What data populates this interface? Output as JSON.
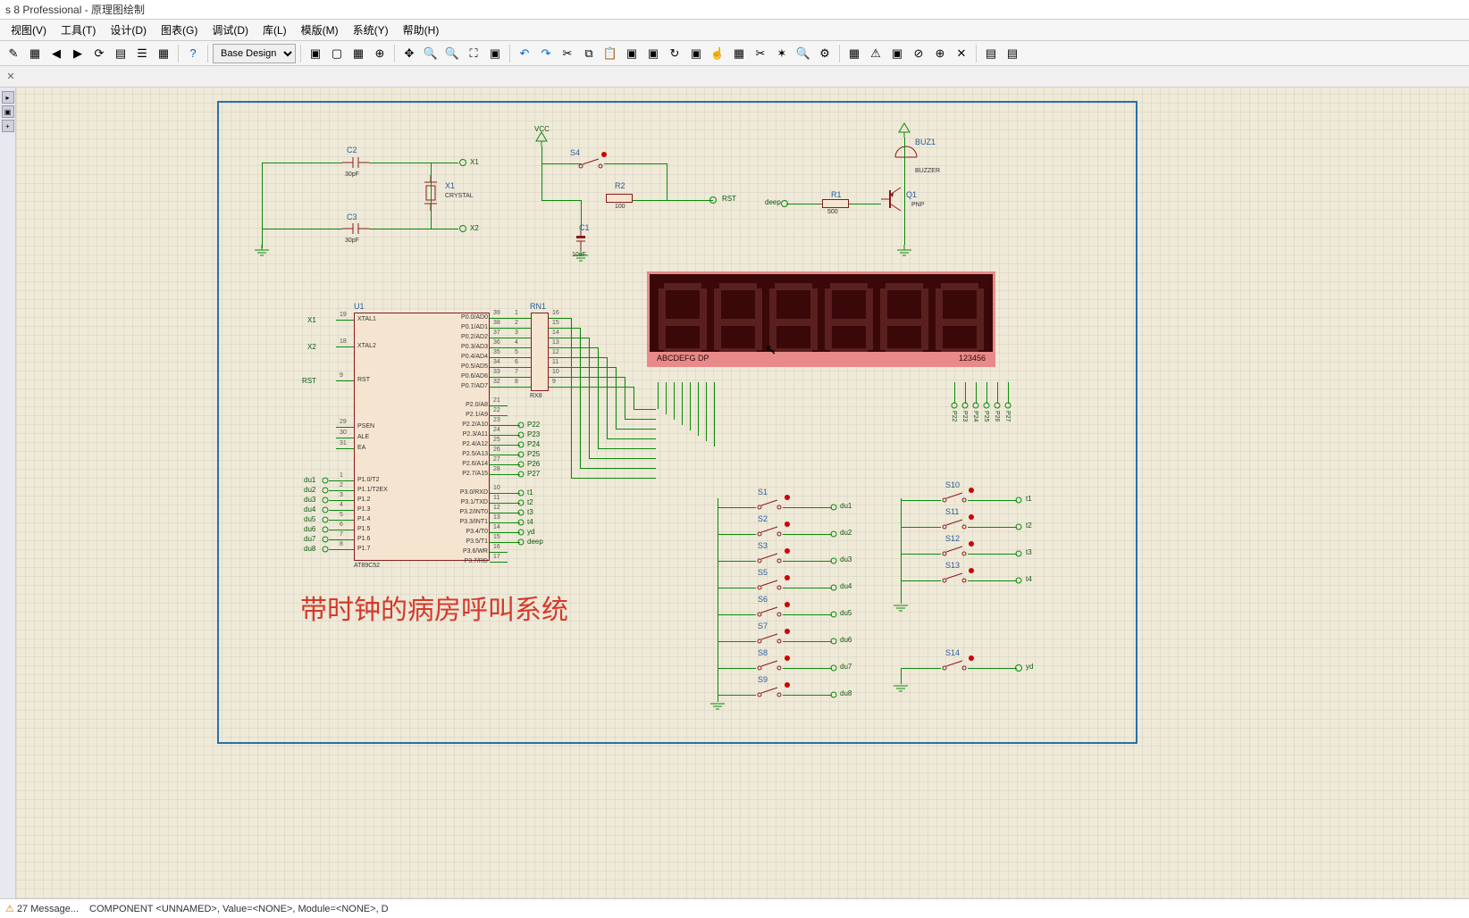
{
  "title": "s 8 Professional - 原理图绘制",
  "menu": [
    "视图(V)",
    "工具(T)",
    "设计(D)",
    "图表(G)",
    "调试(D)",
    "库(L)",
    "模版(M)",
    "系统(Y)",
    "帮助(H)"
  ],
  "design_selector": "Base Design",
  "status": {
    "messages": "27 Message...",
    "component": "COMPONENT <UNNAMED>, Value=<NONE>, Module=<NONE>, D"
  },
  "project_title": "带时钟的病房呼叫系统",
  "components": {
    "c2": {
      "name": "C2",
      "value": "30pF"
    },
    "c3": {
      "name": "C3",
      "value": "30pF"
    },
    "x1": {
      "name": "X1",
      "value": "CRYSTAL"
    },
    "c1": {
      "name": "C1",
      "value": "10uF"
    },
    "r2": {
      "name": "R2",
      "value": "100"
    },
    "r1": {
      "name": "R1",
      "value": "500"
    },
    "q1": {
      "name": "Q1",
      "value": "PNP"
    },
    "buz1": {
      "name": "BUZ1",
      "value": "BUZZER"
    },
    "s4": {
      "name": "S4"
    },
    "u1": {
      "name": "U1",
      "value": "AT89C52"
    },
    "rn1": {
      "name": "RN1",
      "value": "RX8"
    }
  },
  "mcu_pins_left": [
    {
      "num": "19",
      "name": "XTAL1"
    },
    {
      "num": "18",
      "name": "XTAL2"
    },
    {
      "num": "9",
      "name": "RST"
    },
    {
      "num": "29",
      "name": "PSEN"
    },
    {
      "num": "30",
      "name": "ALE"
    },
    {
      "num": "31",
      "name": "EA"
    },
    {
      "num": "1",
      "name": "P1.0/T2"
    },
    {
      "num": "2",
      "name": "P1.1/T2EX"
    },
    {
      "num": "3",
      "name": "P1.2"
    },
    {
      "num": "4",
      "name": "P1.3"
    },
    {
      "num": "5",
      "name": "P1.4"
    },
    {
      "num": "6",
      "name": "P1.5"
    },
    {
      "num": "7",
      "name": "P1.6"
    },
    {
      "num": "8",
      "name": "P1.7"
    }
  ],
  "mcu_pins_right": [
    {
      "num": "39",
      "name": "P0.0/AD0"
    },
    {
      "num": "38",
      "name": "P0.1/AD1"
    },
    {
      "num": "37",
      "name": "P0.2/AD2"
    },
    {
      "num": "36",
      "name": "P0.3/AD3"
    },
    {
      "num": "35",
      "name": "P0.4/AD4"
    },
    {
      "num": "34",
      "name": "P0.5/AD5"
    },
    {
      "num": "33",
      "name": "P0.6/AD6"
    },
    {
      "num": "32",
      "name": "P0.7/AD7"
    },
    {
      "num": "21",
      "name": "P2.0/A8"
    },
    {
      "num": "22",
      "name": "P2.1/A9"
    },
    {
      "num": "23",
      "name": "P2.2/A10"
    },
    {
      "num": "24",
      "name": "P2.3/A11"
    },
    {
      "num": "25",
      "name": "P2.4/A12"
    },
    {
      "num": "26",
      "name": "P2.5/A13"
    },
    {
      "num": "27",
      "name": "P2.6/A14"
    },
    {
      "num": "28",
      "name": "P2.7/A15"
    },
    {
      "num": "10",
      "name": "P3.0/RXD"
    },
    {
      "num": "11",
      "name": "P3.1/TXD"
    },
    {
      "num": "12",
      "name": "P3.2/INT0"
    },
    {
      "num": "13",
      "name": "P3.3/INT1"
    },
    {
      "num": "14",
      "name": "P3.4/T0"
    },
    {
      "num": "15",
      "name": "P3.5/T1"
    },
    {
      "num": "16",
      "name": "P3.6/WR"
    },
    {
      "num": "17",
      "name": "P3.7/RD"
    }
  ],
  "rn1_pins_left": [
    "1",
    "2",
    "3",
    "4",
    "5",
    "6",
    "7",
    "8"
  ],
  "rn1_pins_right": [
    "16",
    "15",
    "14",
    "13",
    "12",
    "11",
    "10",
    "9"
  ],
  "seg_labels_left": "ABCDEFG DP",
  "seg_labels_right": "123456",
  "seg_bottom_pins": [
    "P22",
    "P23",
    "P24",
    "P25",
    "P26",
    "P27"
  ],
  "net_labels": {
    "vcc": "VCC",
    "rst": "RST",
    "deep": "deep",
    "x1t": "X1",
    "x2t": "X2"
  },
  "left_du_labels": [
    "du1",
    "du2",
    "du3",
    "du4",
    "du5",
    "du6",
    "du7",
    "du8"
  ],
  "right_p3_labels": [
    "t1",
    "t2",
    "t3",
    "t4",
    "yd",
    "deep"
  ],
  "p2_labels": [
    "P22",
    "P23",
    "P24",
    "P25",
    "P26",
    "P27"
  ],
  "switches_left": [
    {
      "name": "S1",
      "net": "du1"
    },
    {
      "name": "S2",
      "net": "du2"
    },
    {
      "name": "S3",
      "net": "du3"
    },
    {
      "name": "S5",
      "net": "du4"
    },
    {
      "name": "S6",
      "net": "du5"
    },
    {
      "name": "S7",
      "net": "du6"
    },
    {
      "name": "S8",
      "net": "du7"
    },
    {
      "name": "S9",
      "net": "du8"
    }
  ],
  "switches_right_top": [
    {
      "name": "S10",
      "net": "t1"
    },
    {
      "name": "S11",
      "net": "t2"
    },
    {
      "name": "S12",
      "net": "t3"
    },
    {
      "name": "S13",
      "net": "t4"
    }
  ],
  "switch_s14": {
    "name": "S14",
    "net": "yd"
  }
}
